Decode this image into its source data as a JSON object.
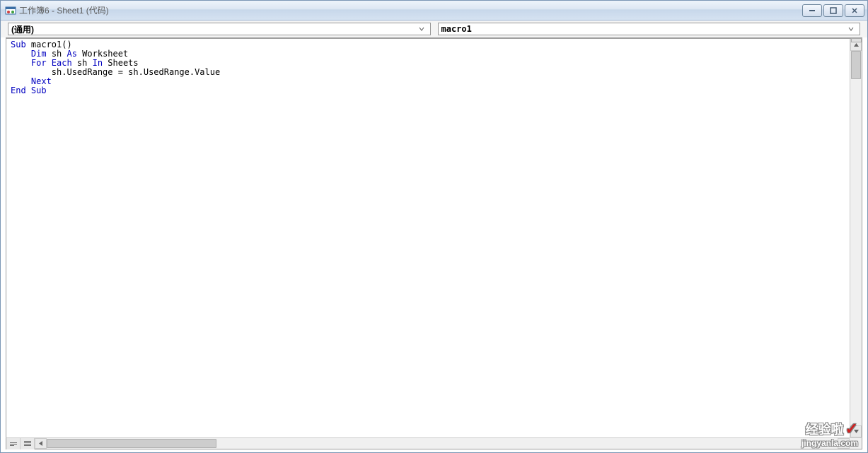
{
  "window": {
    "title": "工作簿6 - Sheet1 (代码)"
  },
  "dropdowns": {
    "left": "(通用)",
    "right": "macro1"
  },
  "code": {
    "lines": [
      {
        "t": "Sub",
        "c": "kw",
        "r": " macro1()"
      },
      {
        "indent": "    ",
        "t": "Dim",
        "c": "kw",
        "r": " sh ",
        "t2": "As",
        "c2": "kw",
        "r2": " Worksheet"
      },
      {
        "indent": "    ",
        "t": "For Each",
        "c": "kw",
        "r": " sh ",
        "t2": "In",
        "c2": "kw",
        "r2": " Sheets"
      },
      {
        "indent": "        ",
        "r": "sh.UsedRange = sh.UsedRange.Value"
      },
      {
        "indent": "    ",
        "t": "Next",
        "c": "kw"
      },
      {
        "t": "End Sub",
        "c": "kw"
      }
    ]
  },
  "watermark": {
    "line1": "经验啦",
    "line2": "jingyanla.com"
  }
}
